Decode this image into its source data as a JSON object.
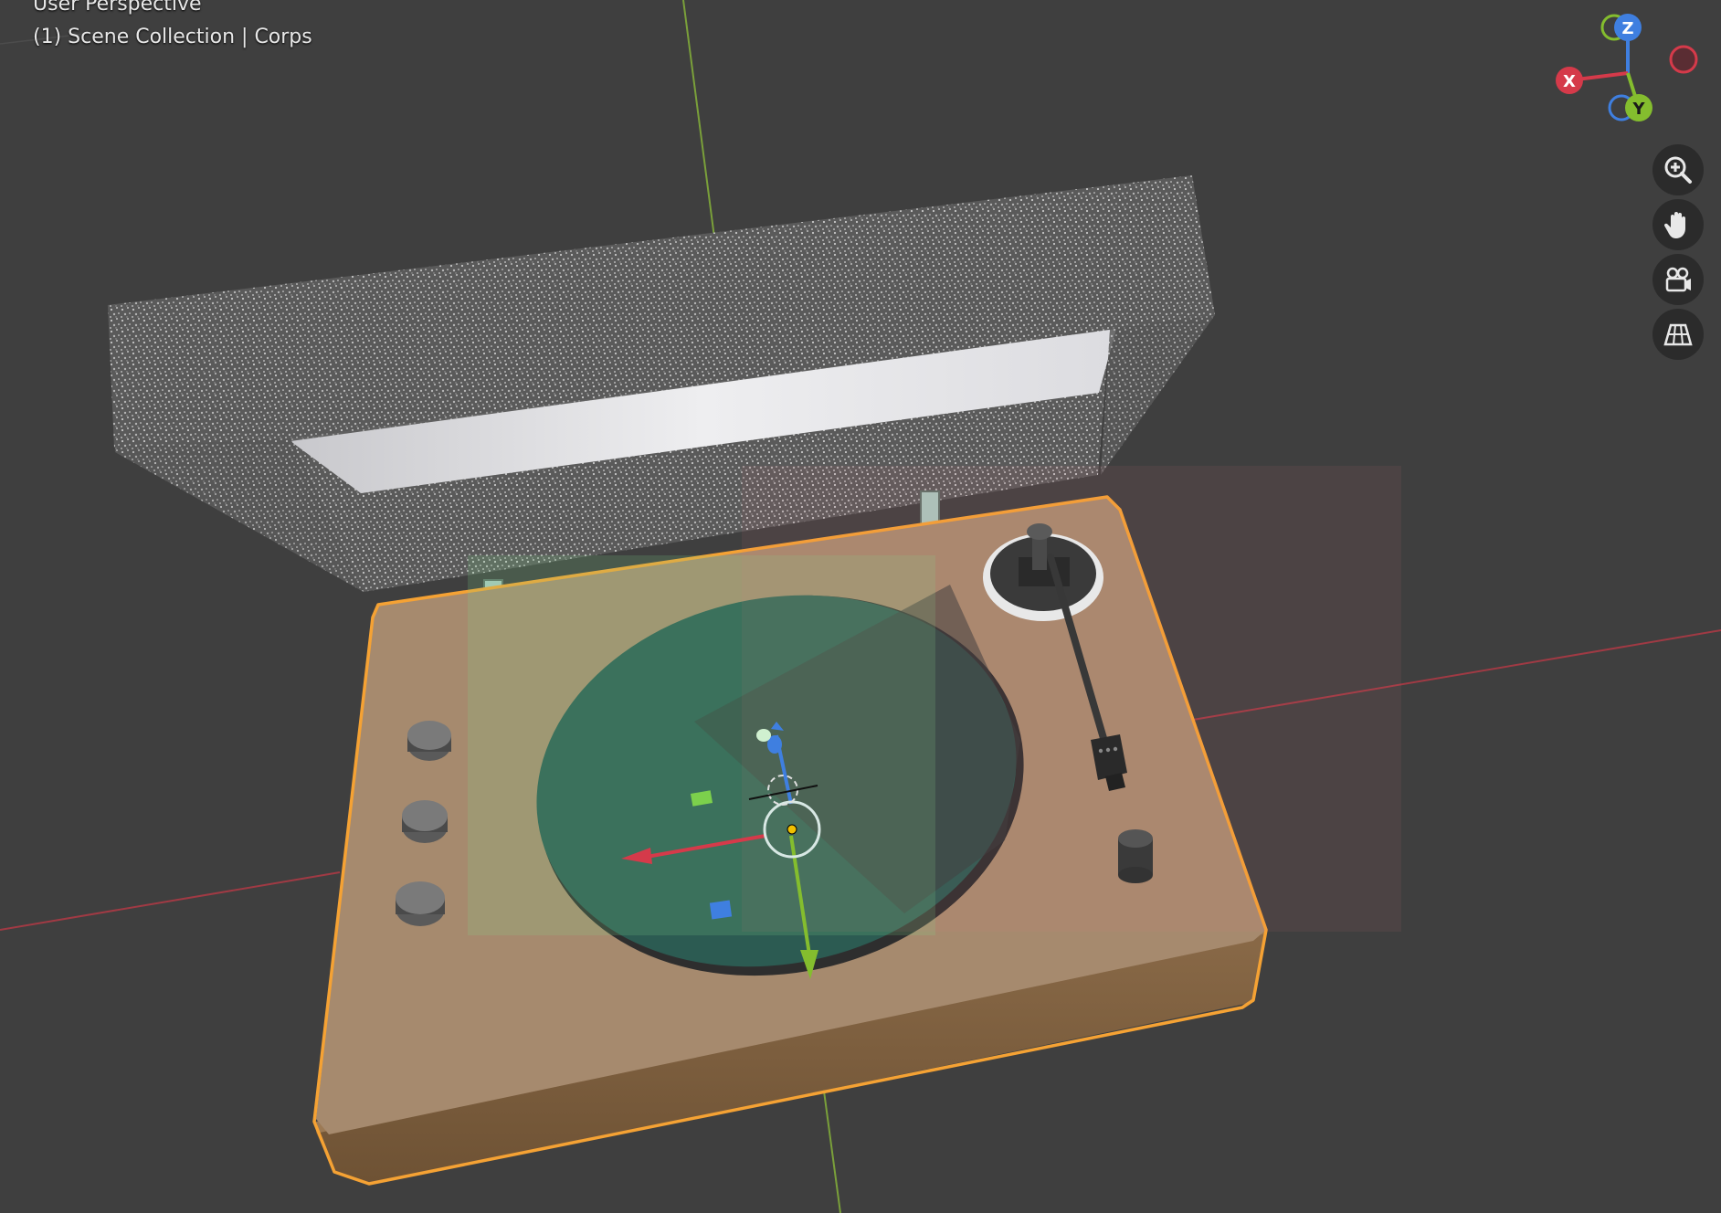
{
  "viewport": {
    "view_label": "User Perspective",
    "collection_label": "(1) Scene Collection | Corps"
  },
  "gizmo": {
    "axis_x": "X",
    "axis_y": "Y",
    "axis_z": "Z",
    "colors": {
      "x": "#d53a4a",
      "y": "#84bd2e",
      "z": "#3f7fe0"
    }
  },
  "nav_buttons": [
    {
      "name": "zoom-icon"
    },
    {
      "name": "hand-pan-icon"
    },
    {
      "name": "camera-view-icon"
    },
    {
      "name": "ortho-grid-icon"
    }
  ],
  "colors": {
    "background": "#3f3f3f",
    "selection_outline": "#f5a234",
    "base_wood": "#a68a6e",
    "platter_teal": "#2c5b52"
  }
}
